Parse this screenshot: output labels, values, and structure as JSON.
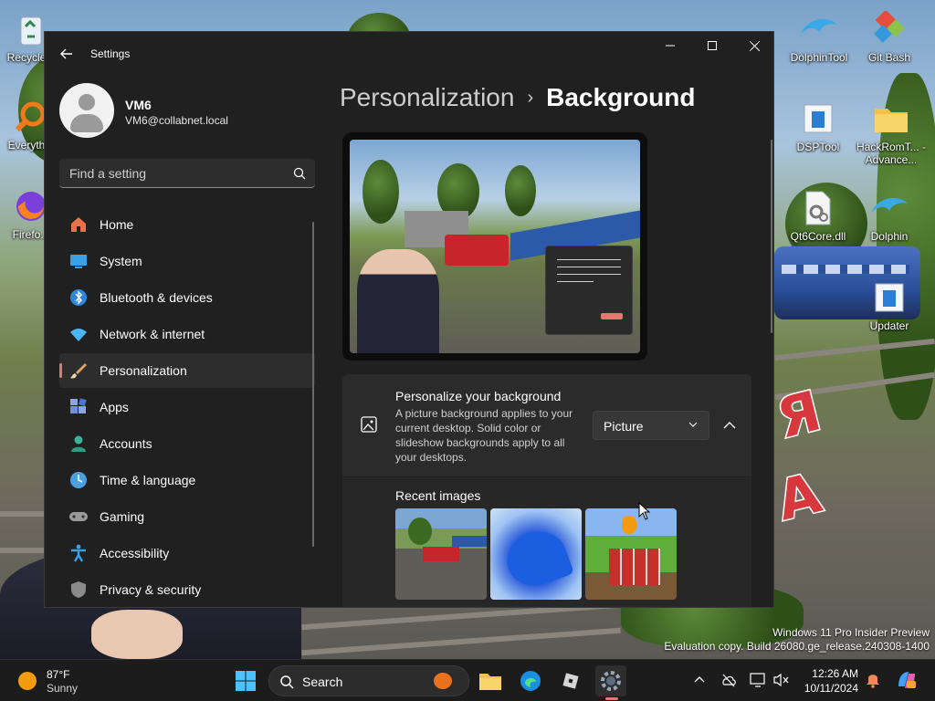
{
  "desktop": {
    "icons": [
      {
        "label": "Recycle..."
      },
      {
        "label": "Everyth..."
      },
      {
        "label": "Firefo..."
      },
      {
        "label": "DolphinTool"
      },
      {
        "label": "Git Bash"
      },
      {
        "label": "DSPTool"
      },
      {
        "label": "HackRomT... - Advance..."
      },
      {
        "label": "Qt6Core.dll"
      },
      {
        "label": "Dolphin"
      },
      {
        "label": "Updater"
      }
    ],
    "wallpaper_text": [
      "Я",
      "А"
    ],
    "watermark": {
      "line1": "Windows 11 Pro Insider Preview",
      "line2": "Evaluation copy. Build 26080.ge_release.240308-1400"
    }
  },
  "settings": {
    "app_title": "Settings",
    "user": {
      "name": "VM6",
      "email": "VM6@collabnet.local"
    },
    "search": {
      "placeholder": "Find a setting"
    },
    "nav": [
      {
        "label": "Home",
        "icon": "home-icon",
        "color": "#e8734a"
      },
      {
        "label": "System",
        "icon": "monitor-icon",
        "color": "#3aa0e8"
      },
      {
        "label": "Bluetooth & devices",
        "icon": "bluetooth-icon",
        "color": "#2f86d8"
      },
      {
        "label": "Network & internet",
        "icon": "wifi-icon",
        "color": "#4cb5f5"
      },
      {
        "label": "Personalization",
        "icon": "paintbrush-icon",
        "color": "#e0a36a",
        "active": true
      },
      {
        "label": "Apps",
        "icon": "apps-icon",
        "color": "#6c8fd8"
      },
      {
        "label": "Accounts",
        "icon": "person-icon",
        "color": "#3bb39a"
      },
      {
        "label": "Time & language",
        "icon": "clock-globe-icon",
        "color": "#4ca0e0"
      },
      {
        "label": "Gaming",
        "icon": "gamepad-icon",
        "color": "#9a9a9a"
      },
      {
        "label": "Accessibility",
        "icon": "accessibility-icon",
        "color": "#3a9ee8"
      },
      {
        "label": "Privacy & security",
        "icon": "shield-icon",
        "color": "#8a8a8a"
      }
    ],
    "breadcrumb": {
      "parent": "Personalization",
      "separator": "›",
      "current": "Background"
    },
    "background_card": {
      "title": "Personalize your background",
      "description": "A picture background applies to your current desktop. Solid color or slideshow backgrounds apply to all your desktops.",
      "dropdown_value": "Picture"
    },
    "recent": {
      "label": "Recent images",
      "thumbs": [
        {
          "name": "train-wallpaper-thumb"
        },
        {
          "name": "windows11-bloom-thumb"
        },
        {
          "name": "minecraft-tnt-thumb"
        }
      ]
    },
    "accent_color": "#e07a6f"
  },
  "taskbar": {
    "weather": {
      "temp": "87°F",
      "condition": "Sunny"
    },
    "search_label": "Search",
    "clock": {
      "time": "12:26 AM",
      "date": "10/11/2024"
    }
  }
}
